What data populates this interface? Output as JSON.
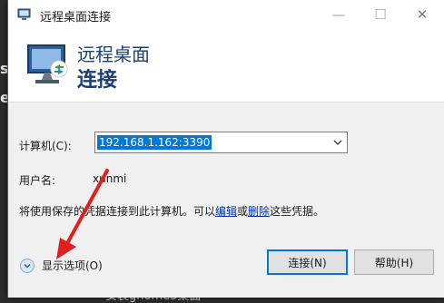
{
  "background": {
    "fragment_s": "s",
    "fragment_e": "e",
    "bottom_text": "安装gnome3桌面"
  },
  "window": {
    "title": "远程桌面连接",
    "controls": {
      "minimize": "—",
      "maximize": "☐",
      "close": "✕"
    }
  },
  "header": {
    "line1": "远程桌面",
    "line2": "连接"
  },
  "form": {
    "computer_label": "计算机(C):",
    "computer_value": "192.168.1.162:3390",
    "user_label": "用户名:",
    "user_value": "xunmi",
    "info_prefix": "将使用保存的凭据连接到此计算机。可以",
    "info_edit_link": "编辑",
    "info_or": "或",
    "info_delete_link": "删除",
    "info_suffix": "这些凭据。"
  },
  "options": {
    "label": "显示选项(O)"
  },
  "buttons": {
    "connect": "连接(N)",
    "help": "帮助(H)"
  },
  "colors": {
    "accent": "#0078d7",
    "header_text": "#1e3f6e",
    "annotation_arrow": "#e02020"
  }
}
